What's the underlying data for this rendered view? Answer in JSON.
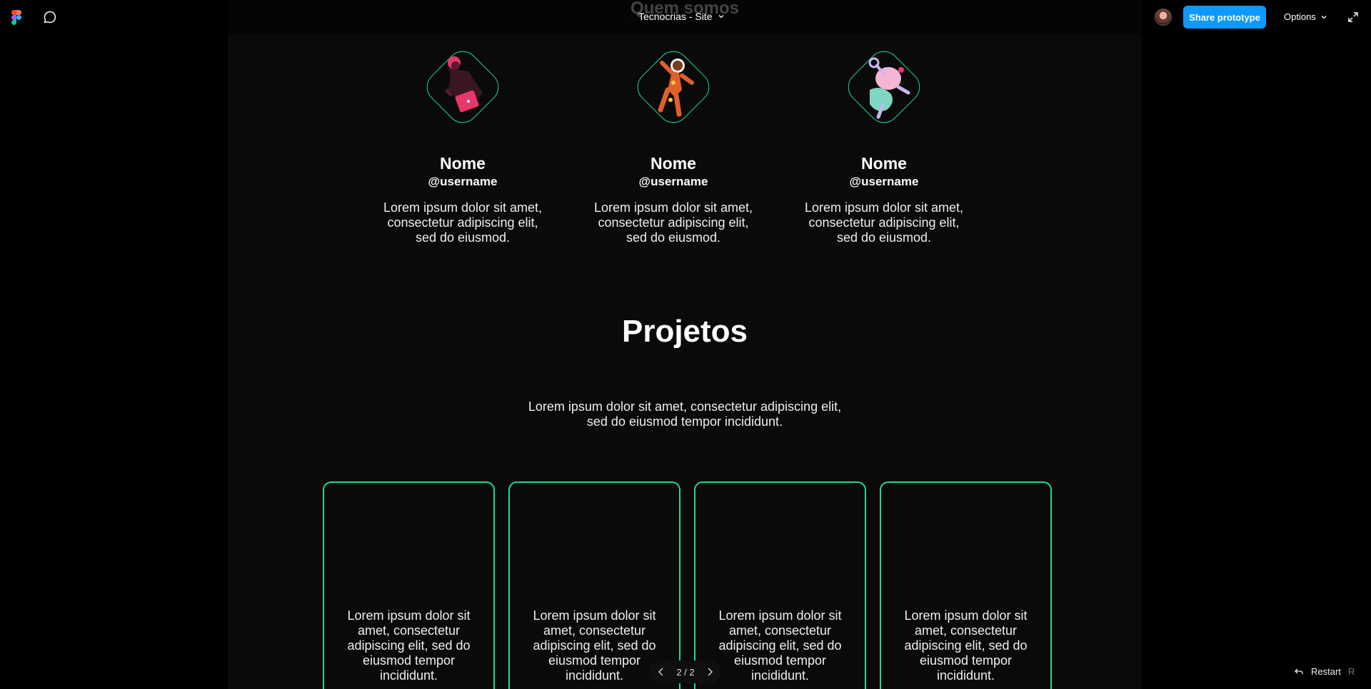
{
  "topbar": {
    "file_title": "Tecnocrias - Site",
    "share_label": "Share prototype",
    "options_label": "Options"
  },
  "frame": {
    "section_title_top": "Quem somos",
    "members": [
      {
        "name": "Nome",
        "username": "@username",
        "desc": "Lorem ipsum dolor sit amet, consectetur adipiscing elit, sed do eiusmod."
      },
      {
        "name": "Nome",
        "username": "@username",
        "desc": "Lorem ipsum dolor sit amet, consectetur adipiscing elit, sed do eiusmod."
      },
      {
        "name": "Nome",
        "username": "@username",
        "desc": "Lorem ipsum dolor sit amet, consectetur adipiscing elit, sed do eiusmod."
      }
    ],
    "projects_title": "Projetos",
    "projects_desc": "Lorem ipsum dolor sit amet, consectetur adipiscing elit, sed do eiusmod tempor incididunt.",
    "cards": [
      {
        "text": "Lorem ipsum dolor sit amet, consectetur adipiscing elit, sed do eiusmod tempor incididunt."
      },
      {
        "text": "Lorem ipsum dolor sit amet, consectetur adipiscing elit, sed do eiusmod tempor incididunt."
      },
      {
        "text": "Lorem ipsum dolor sit amet, consectetur adipiscing elit, sed do eiusmod tempor incididunt."
      },
      {
        "text": "Lorem ipsum dolor sit amet, consectetur adipiscing elit, sed do eiusmod tempor incididunt."
      }
    ]
  },
  "controls": {
    "page_indicator": "2 / 2",
    "restart_label": "Restart",
    "restart_key": "R"
  },
  "colors": {
    "accent_green": "#1ed99a",
    "share_blue": "#0d99ff"
  },
  "icons": [
    "figma-logo-icon",
    "comment-icon",
    "chevron-down-icon",
    "expand-icon",
    "chevron-left-icon",
    "chevron-right-icon",
    "restart-icon"
  ]
}
